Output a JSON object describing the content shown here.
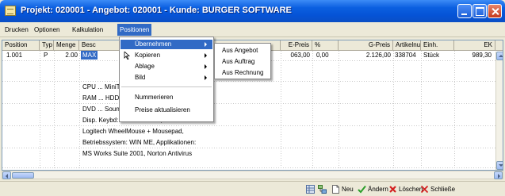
{
  "window": {
    "title": "Projekt: 020001 - Angebot: 020001 - Kunde: BURGER SOFTWARE"
  },
  "menubar": {
    "items": [
      "Drucken",
      "Optionen",
      "Kalkulation",
      "Positionen"
    ]
  },
  "grid": {
    "columns": [
      "Position",
      "Typ",
      "Menge",
      "Besc",
      "E-Preis",
      "%",
      "G-Preis",
      "Artikelnumme",
      "Einh.",
      "EK"
    ],
    "row": {
      "position": "1.001",
      "typ": "P",
      "menge": "2.00",
      "beschreibung": "MAX",
      "epreis": "063,00",
      "rabatt": "0,00",
      "gpreis": "2.126,00",
      "artikelnummer": "338704",
      "einheit": "Stück",
      "ek": "989,30"
    },
    "description_lines": [
      "CPU ...                MiniTower,",
      "RAM ...                HDD: 20 GB,",
      "DVD ...                Sound: in",
      "Disp. Keybd: Stand. D PS/2, Mouse:",
      "Logitech WheelMouse + Mousepad,",
      "Betriebssystem: WIN ME, Applikationen:",
      "MS Works Suite 2001, Norton Antivirus"
    ]
  },
  "positionen_menu": {
    "items": [
      {
        "label": "Übernehmen",
        "submenu": true,
        "highlighted": true
      },
      {
        "label": "Kopieren",
        "submenu": true
      },
      {
        "label": "Ablage",
        "submenu": true
      },
      {
        "label": "Bild",
        "submenu": true
      },
      {
        "label": "Nummerieren"
      },
      {
        "label": "Preise aktualisieren"
      }
    ]
  },
  "uebernehmen_submenu": {
    "items": [
      "Aus Angebot",
      "Aus Auftrag",
      "Aus Rechnung"
    ]
  },
  "toolbar": {
    "neu": "Neu",
    "aendern": "Ändern",
    "loeschen": "Löschen",
    "schliessen": "Schließe"
  },
  "colors": {
    "titlebar": "#0553d6",
    "highlight": "#316ac5",
    "check": "#2a9d2a",
    "delete": "#d32020"
  }
}
